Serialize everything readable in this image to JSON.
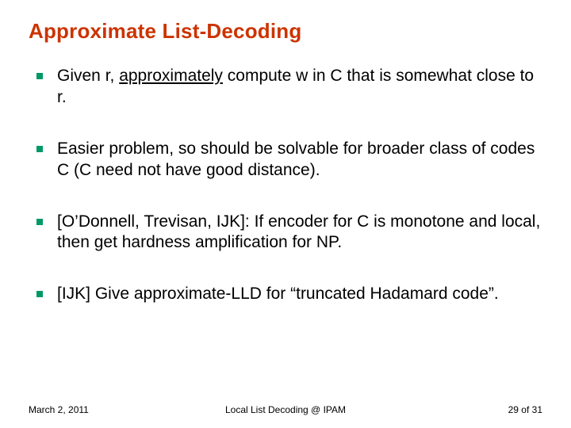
{
  "title": "Approximate List-Decoding",
  "bullets": [
    {
      "pre": "Given r, ",
      "underlined": "approximately",
      "post": " compute w in C that is somewhat close to r."
    },
    {
      "pre": "Easier problem, so should be solvable for broader class of codes C (C need not have good distance).",
      "underlined": "",
      "post": ""
    },
    {
      "pre": "[O’Donnell, Trevisan, IJK]: If encoder for C is monotone and local, then get hardness amplification for NP.",
      "underlined": "",
      "post": ""
    },
    {
      "pre": "[IJK] Give approximate-LLD for “truncated Hadamard code”.",
      "underlined": "",
      "post": ""
    }
  ],
  "footer": {
    "date": "March 2, 2011",
    "venue": "Local List Decoding @ IPAM",
    "page_current": "29",
    "page_sep": " of ",
    "page_total": "31"
  }
}
